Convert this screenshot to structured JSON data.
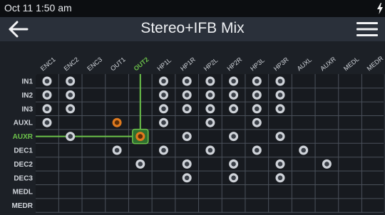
{
  "status_bar": {
    "time": "Oct 11 1:50 am",
    "battery_icon": "charging-bolt-icon"
  },
  "header": {
    "title": "Stereo+IFB Mix",
    "back_icon": "back-arrow-icon",
    "menu_icon": "hamburger-menu-icon"
  },
  "colors": {
    "background": "#1c2026",
    "title_bar": "#2a303a",
    "grid_line": "#4a505a",
    "node_normal": "#cfd3d9",
    "node_active": "#e07a1e",
    "selection": "#6cc24a",
    "selected_fill": "#2e6e2e"
  },
  "matrix": {
    "columns": [
      "ENC1",
      "ENC2",
      "ENC3",
      "OUT1",
      "OUT2",
      "HP1L",
      "HP1R",
      "HP2L",
      "HP2R",
      "HP3L",
      "HP3R",
      "AUXL",
      "AUXR",
      "MEDL",
      "MEDR"
    ],
    "rows": [
      "IN1",
      "IN2",
      "IN3",
      "AUXL",
      "AUXR",
      "DEC1",
      "DEC2",
      "DEC3",
      "MEDL",
      "MEDR"
    ],
    "selected_row": "AUXR",
    "selected_column": "OUT2",
    "selected_cell": {
      "row": "AUXR",
      "column": "OUT2"
    },
    "crosspoints": [
      {
        "row": "IN1",
        "columns": [
          "ENC1",
          "ENC2",
          "HP1L",
          "HP1R",
          "HP2L",
          "HP2R",
          "HP3L",
          "HP3R"
        ]
      },
      {
        "row": "IN2",
        "columns": [
          "ENC1",
          "ENC2",
          "HP1L",
          "HP1R",
          "HP2L",
          "HP2R",
          "HP3L",
          "HP3R"
        ]
      },
      {
        "row": "IN3",
        "columns": [
          "ENC1",
          "ENC2",
          "HP1L",
          "HP1R",
          "HP2L",
          "HP2R",
          "HP3L",
          "HP3R"
        ]
      },
      {
        "row": "AUXL",
        "columns": [
          "ENC1",
          "OUT1",
          "HP1L",
          "HP2L",
          "HP3L"
        ]
      },
      {
        "row": "AUXR",
        "columns": [
          "ENC2",
          "OUT2",
          "HP1R",
          "HP2R",
          "HP3R"
        ]
      },
      {
        "row": "DEC1",
        "columns": [
          "OUT1",
          "HP1L",
          "HP2L",
          "HP3L",
          "AUXL"
        ]
      },
      {
        "row": "DEC2",
        "columns": [
          "OUT2",
          "HP1R",
          "HP2R",
          "HP3R",
          "AUXR"
        ]
      },
      {
        "row": "DEC3",
        "columns": [
          "HP1R",
          "HP2R",
          "HP3R"
        ]
      },
      {
        "row": "MEDL",
        "columns": []
      },
      {
        "row": "MEDR",
        "columns": []
      }
    ],
    "active_crosspoints": [
      {
        "row": "AUXL",
        "column": "OUT1"
      },
      {
        "row": "AUXR",
        "column": "OUT2"
      }
    ]
  }
}
